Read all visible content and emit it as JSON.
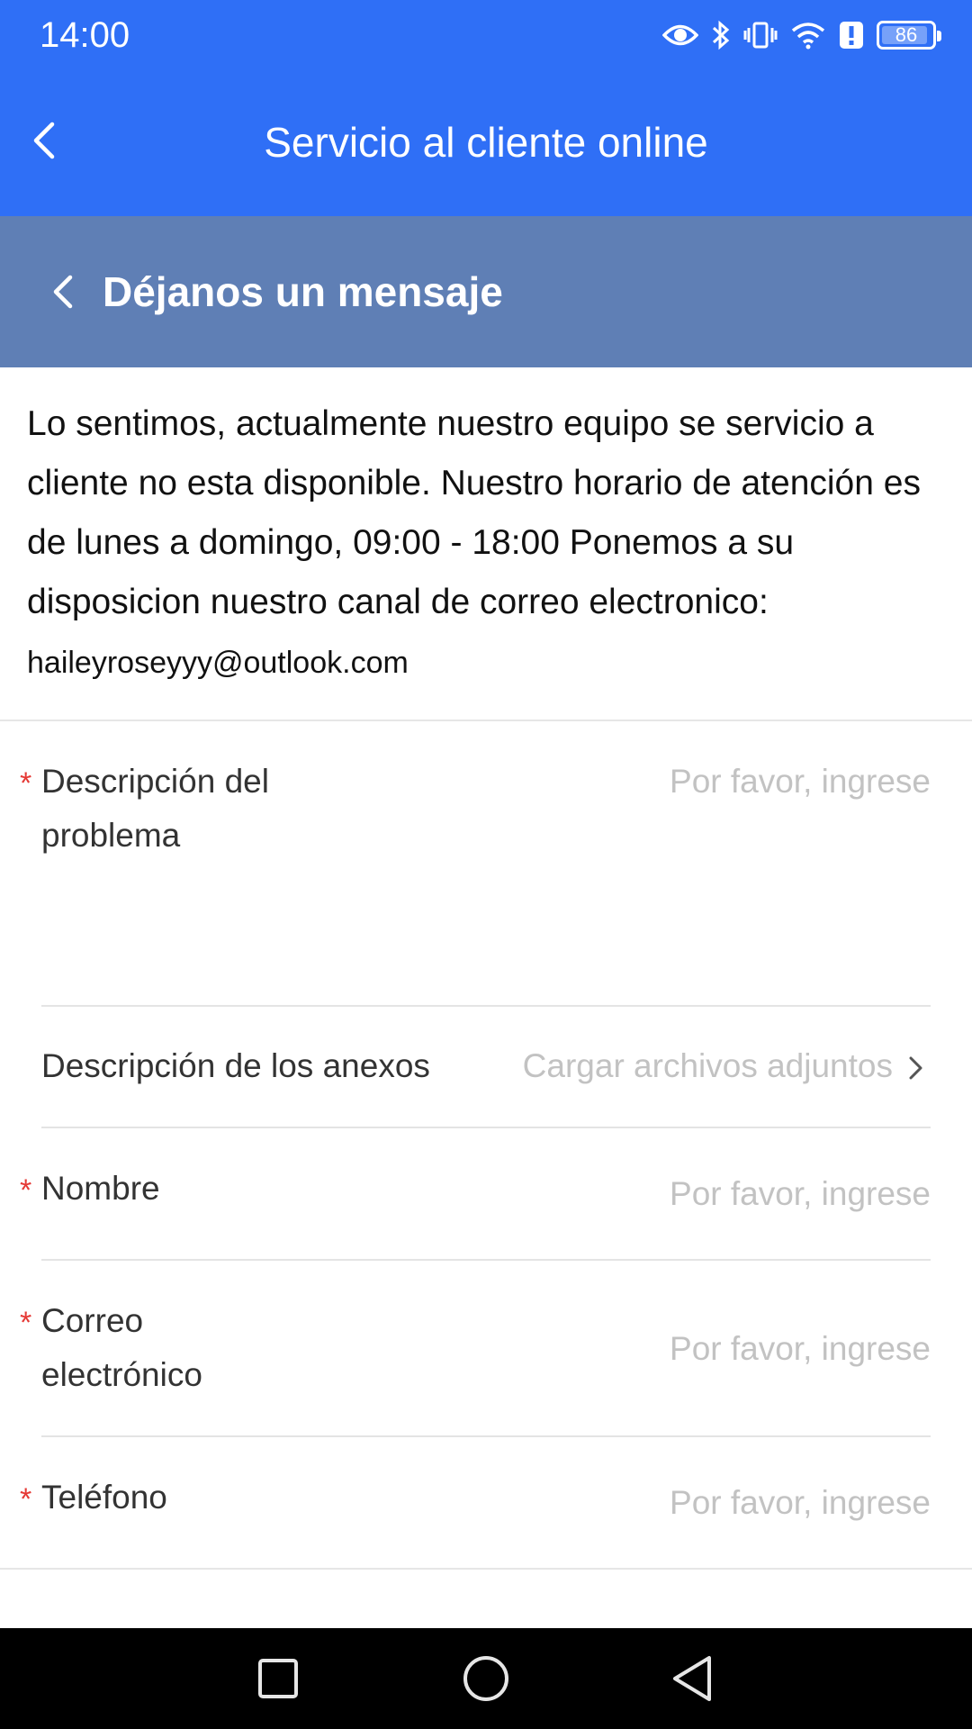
{
  "status_bar": {
    "time": "14:00",
    "battery": "86",
    "icons": [
      "eye-icon",
      "bluetooth-icon",
      "vibrate-icon",
      "wifi-icon",
      "alert-icon",
      "battery-icon"
    ]
  },
  "header": {
    "title": "Servicio al cliente online",
    "back_icon": "chevron-left-icon"
  },
  "subheader": {
    "title": "Déjanos un mensaje",
    "back_icon": "chevron-left-icon"
  },
  "message": {
    "text": "Lo sentimos, actualmente nuestro equipo se servicio a cliente no esta disponible. Nuestro horario de atención es de lunes a domingo, 09:00 - 18:00 Ponemos a su disposicion nuestro canal de correo electronico: ",
    "email": "haileyroseyyy@outlook.com"
  },
  "form": {
    "problem": {
      "required": "*",
      "label_line1": "Descripción del",
      "label_line2": "problema",
      "placeholder": "Por favor, ingrese"
    },
    "attachments": {
      "label": "Descripción de los anexos",
      "action": "Cargar archivos adjuntos"
    },
    "name": {
      "required": "*",
      "label": "Nombre",
      "placeholder": "Por favor, ingrese"
    },
    "email": {
      "required": "*",
      "label_line1": "Correo",
      "label_line2": "electrónico",
      "placeholder": "Por favor, ingrese"
    },
    "phone": {
      "required": "*",
      "label": "Teléfono",
      "placeholder": "Por favor, ingrese"
    }
  },
  "colors": {
    "header": "#2f6ff6",
    "subheader": "#5f7fb5",
    "required": "#e53935",
    "placeholder": "#c2c2c2"
  },
  "nav": {
    "icons": [
      "recents-square-icon",
      "home-circle-icon",
      "back-triangle-icon"
    ]
  }
}
